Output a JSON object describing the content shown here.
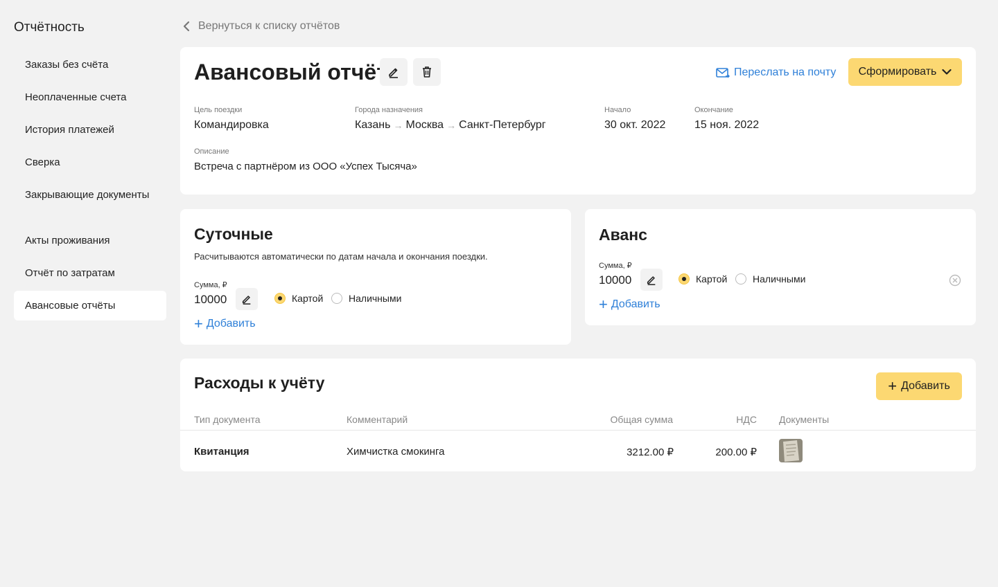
{
  "sidebar": {
    "title": "Отчётность",
    "items": [
      {
        "label": "Заказы без счёта"
      },
      {
        "label": "Неоплаченные счета"
      },
      {
        "label": "История платежей"
      },
      {
        "label": "Сверка"
      },
      {
        "label": "Закрывающие документы"
      },
      {
        "label": "Акты проживания"
      },
      {
        "label": "Отчёт по затратам"
      },
      {
        "label": "Авансовые отчёты"
      }
    ],
    "active_index": 7
  },
  "back_link": "Вернуться к списку отчётов",
  "report": {
    "title": "Авансовый отчёт",
    "email_label": "Переслать на почту",
    "generate_label": "Сформировать",
    "purpose_label": "Цель поездки",
    "purpose_value": "Командировка",
    "cities_label": "Города назначения",
    "cities": [
      "Казань",
      "Москва",
      "Санкт-Петербург"
    ],
    "start_label": "Начало",
    "start_value": "30 окт. 2022",
    "end_label": "Окончание",
    "end_value": "15 ноя. 2022",
    "description_label": "Описание",
    "description_value": "Встреча с партнёром из ООО «Успех Тысяча»"
  },
  "per_diem": {
    "title": "Суточные",
    "description": "Расчитываются автоматически по датам начала и окончания поездки.",
    "sum_label": "Сумма, ₽",
    "sum_value": "10000",
    "option_card": "Картой",
    "option_cash": "Наличными",
    "selected": "card",
    "add_label": "Добавить"
  },
  "advance": {
    "title": "Аванс",
    "sum_label": "Сумма, ₽",
    "sum_value": "10000",
    "option_card": "Картой",
    "option_cash": "Наличными",
    "selected": "card",
    "add_label": "Добавить"
  },
  "expenses": {
    "title": "Расходы к учёту",
    "add_label": "Добавить",
    "columns": {
      "doc_type": "Тип документа",
      "comment": "Комментарий",
      "total": "Общая сумма",
      "vat": "НДС",
      "documents": "Документы"
    },
    "rows": [
      {
        "doc_type": "Квитанция",
        "comment": "Химчистка смокинга",
        "total": "3212.00 ₽",
        "vat": "200.00 ₽"
      }
    ]
  },
  "colors": {
    "accent_yellow": "#fcd872",
    "link_blue": "#2f80d8",
    "background": "#f2f2f2"
  }
}
